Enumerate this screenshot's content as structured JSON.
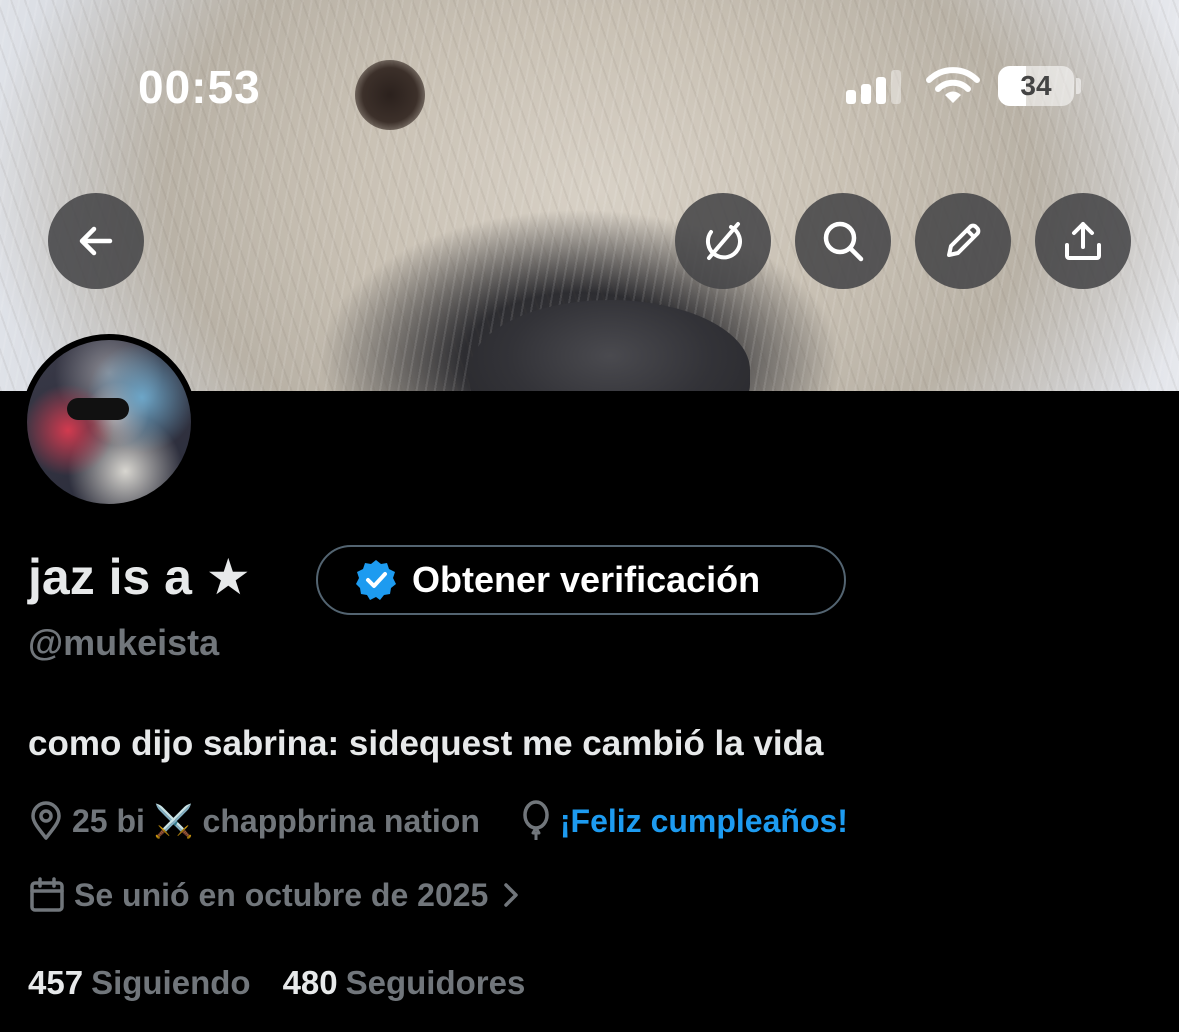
{
  "status_bar": {
    "time": "00:53",
    "battery_level": "34",
    "signal_bars_active": 3,
    "signal_bars_total": 4
  },
  "header_actions": {
    "back_icon": "arrow-left-icon",
    "grok_icon": "grok-icon",
    "search_icon": "search-icon",
    "edit_icon": "pencil-icon",
    "share_icon": "share-icon"
  },
  "profile": {
    "display_name": "jaz is a ★",
    "verify_button_label": "Obtener verificación",
    "handle": "@mukeista",
    "bio": "como dijo sabrina: sidequest me cambió la vida",
    "location": "25 bi ⚔️ chappbrina nation",
    "birthday": "¡Feliz cumpleaños!",
    "joined": "Se unió en octubre de 2025",
    "following_count": "457",
    "following_label": "Siguiendo",
    "followers_count": "480",
    "followers_label": "Seguidores"
  },
  "colors": {
    "background": "#000000",
    "link_blue": "#1d9bf0",
    "muted_text": "#71767b",
    "primary_text": "#e7e9ea",
    "verified_badge": "#1d9bf0"
  }
}
